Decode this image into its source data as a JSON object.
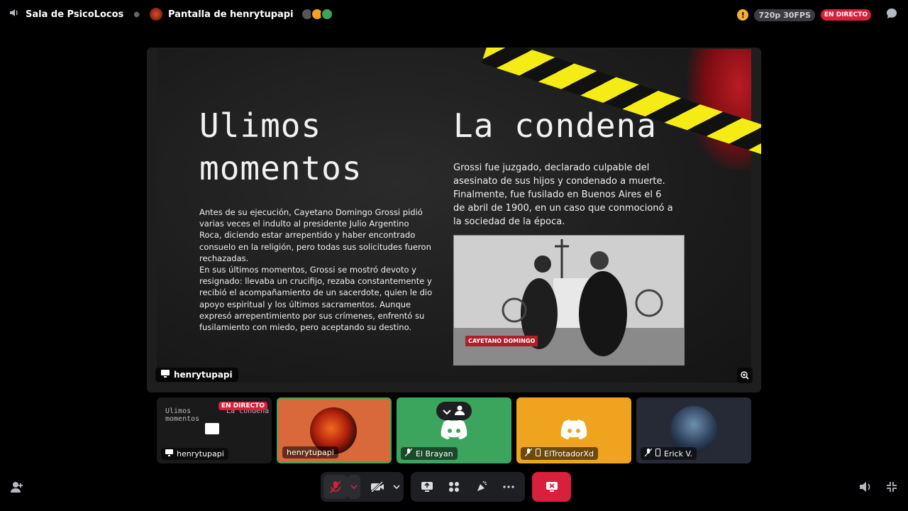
{
  "topbar": {
    "voice_channel": "Sala de PsicoLocos",
    "screen_title": "Pantalla de henrytupapi",
    "quality": "720p 30FPS",
    "live_badge": "EN DIRECTO"
  },
  "slide": {
    "left_heading": "Ulimos momentos",
    "left_body_1": "Antes de su ejecución, Cayetano Domingo Grossi pidió varias veces el indulto al presidente Julio Argentino Roca, diciendo estar arrepentido y haber encontrado consuelo en la religión, pero todas sus solicitudes fueron rechazadas.",
    "left_body_2": "En sus últimos momentos, Grossi se mostró devoto y resignado: llevaba un crucifijo, rezaba constantemente y recibió el acompañamiento de un sacerdote, quien le dio apoyo espiritual y los últimos sacramentos. Aunque expresó arrepentimiento por sus crímenes, enfrentó su fusilamiento con miedo, pero aceptando su destino.",
    "right_heading": "La condena",
    "right_body": "Grossi fue juzgado, declarado culpable del asesinato de sus hijos y condenado a muerte. Finalmente, fue fusilado en Buenos Aires el 6 de abril de 1900, en un caso que conmocionó a la sociedad de la época.",
    "photo_caption": "CAYETANO DOMINGO"
  },
  "stage_label": "henrytupapi",
  "tiles": [
    {
      "name": "henrytupapi",
      "live": "EN DIRECTO",
      "preview_left": "Ulimos momentos",
      "preview_right": "La condena",
      "bg": "#1a1a1a"
    },
    {
      "name": "henrytupapi",
      "bg": "#d9683a"
    },
    {
      "name": "El Brayan",
      "bg": "#3ba55d"
    },
    {
      "name": "ElTrotadorXd",
      "bg": "#f0a31e"
    },
    {
      "name": "Erick V.",
      "bg": "#262a36"
    }
  ],
  "colors": {
    "accent_red": "#d8203c",
    "discord_green": "#3ba55d",
    "discord_yellow": "#f0a31e"
  }
}
